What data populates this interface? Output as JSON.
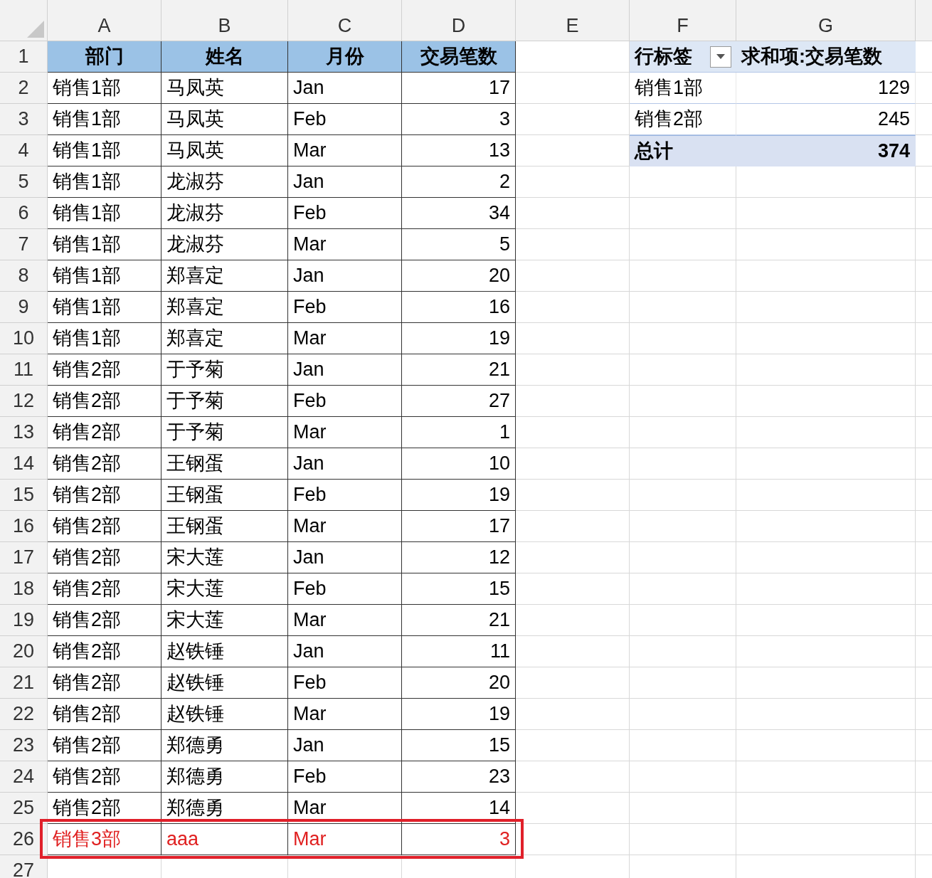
{
  "column_headers": [
    "A",
    "B",
    "C",
    "D",
    "E",
    "F",
    "G"
  ],
  "table": {
    "header_row_number": "1",
    "columns": [
      "部门",
      "姓名",
      "月份",
      "交易笔数"
    ],
    "rows": [
      {
        "number": "2",
        "cells": [
          "销售1部",
          "马凤英",
          "Jan",
          "17"
        ],
        "highlighted": false
      },
      {
        "number": "3",
        "cells": [
          "销售1部",
          "马凤英",
          "Feb",
          "3"
        ],
        "highlighted": false
      },
      {
        "number": "4",
        "cells": [
          "销售1部",
          "马凤英",
          "Mar",
          "13"
        ],
        "highlighted": false
      },
      {
        "number": "5",
        "cells": [
          "销售1部",
          "龙淑芬",
          "Jan",
          "2"
        ],
        "highlighted": false
      },
      {
        "number": "6",
        "cells": [
          "销售1部",
          "龙淑芬",
          "Feb",
          "34"
        ],
        "highlighted": false
      },
      {
        "number": "7",
        "cells": [
          "销售1部",
          "龙淑芬",
          "Mar",
          "5"
        ],
        "highlighted": false
      },
      {
        "number": "8",
        "cells": [
          "销售1部",
          "郑喜定",
          "Jan",
          "20"
        ],
        "highlighted": false
      },
      {
        "number": "9",
        "cells": [
          "销售1部",
          "郑喜定",
          "Feb",
          "16"
        ],
        "highlighted": false
      },
      {
        "number": "10",
        "cells": [
          "销售1部",
          "郑喜定",
          "Mar",
          "19"
        ],
        "highlighted": false
      },
      {
        "number": "11",
        "cells": [
          "销售2部",
          "于予菊",
          "Jan",
          "21"
        ],
        "highlighted": false
      },
      {
        "number": "12",
        "cells": [
          "销售2部",
          "于予菊",
          "Feb",
          "27"
        ],
        "highlighted": false
      },
      {
        "number": "13",
        "cells": [
          "销售2部",
          "于予菊",
          "Mar",
          "1"
        ],
        "highlighted": false
      },
      {
        "number": "14",
        "cells": [
          "销售2部",
          "王钢蛋",
          "Jan",
          "10"
        ],
        "highlighted": false
      },
      {
        "number": "15",
        "cells": [
          "销售2部",
          "王钢蛋",
          "Feb",
          "19"
        ],
        "highlighted": false
      },
      {
        "number": "16",
        "cells": [
          "销售2部",
          "王钢蛋",
          "Mar",
          "17"
        ],
        "highlighted": false
      },
      {
        "number": "17",
        "cells": [
          "销售2部",
          "宋大莲",
          "Jan",
          "12"
        ],
        "highlighted": false
      },
      {
        "number": "18",
        "cells": [
          "销售2部",
          "宋大莲",
          "Feb",
          "15"
        ],
        "highlighted": false
      },
      {
        "number": "19",
        "cells": [
          "销售2部",
          "宋大莲",
          "Mar",
          "21"
        ],
        "highlighted": false
      },
      {
        "number": "20",
        "cells": [
          "销售2部",
          "赵铁锤",
          "Jan",
          "11"
        ],
        "highlighted": false
      },
      {
        "number": "21",
        "cells": [
          "销售2部",
          "赵铁锤",
          "Feb",
          "20"
        ],
        "highlighted": false
      },
      {
        "number": "22",
        "cells": [
          "销售2部",
          "赵铁锤",
          "Mar",
          "19"
        ],
        "highlighted": false
      },
      {
        "number": "23",
        "cells": [
          "销售2部",
          "郑德勇",
          "Jan",
          "15"
        ],
        "highlighted": false
      },
      {
        "number": "24",
        "cells": [
          "销售2部",
          "郑德勇",
          "Feb",
          "23"
        ],
        "highlighted": false
      },
      {
        "number": "25",
        "cells": [
          "销售2部",
          "郑德勇",
          "Mar",
          "14"
        ],
        "highlighted": false
      },
      {
        "number": "26",
        "cells": [
          "销售3部",
          "aaa",
          "Mar",
          "3"
        ],
        "highlighted": true
      }
    ],
    "trailing_row_number": "27"
  },
  "pivot": {
    "row_label": "行标签",
    "value_label": "求和项:交易笔数",
    "rows": [
      {
        "kind": "item",
        "label": "销售1部",
        "value": "129"
      },
      {
        "kind": "item",
        "label": "销售2部",
        "value": "245"
      },
      {
        "kind": "total",
        "label": "总计",
        "value": "374"
      }
    ]
  }
}
